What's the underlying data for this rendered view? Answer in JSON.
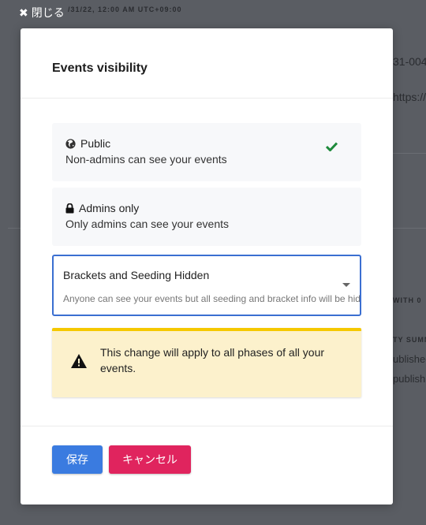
{
  "close": {
    "label": "閉じる"
  },
  "background": {
    "date_text": "/31/22, 12:00 AM UTC+09:00",
    "id_text": "31-004",
    "url_text": "https://",
    "with_text": "WITH 0",
    "summary_text": "TY SUMM",
    "published_1": "ublished",
    "published_2": "publish"
  },
  "modal": {
    "title": "Events visibility",
    "options": [
      {
        "title": "Public",
        "description": "Non-admins can see your events",
        "selected": true
      },
      {
        "title": "Admins only",
        "description": "Only admins can see your events",
        "selected": false
      }
    ],
    "dropdown": {
      "value": "Brackets and Seeding Hidden",
      "description": "Anyone can see your events but all seeding and bracket info will be hidden"
    },
    "warning": {
      "text": "This change will apply to all phases of all your events."
    },
    "buttons": {
      "save": "保存",
      "cancel": "キャンセル"
    }
  },
  "colors": {
    "accent_blue": "#3a7be0",
    "cancel_pink": "#e0245e",
    "warning_bg": "#fcf1cc",
    "warning_border": "#f5c800",
    "check_green": "#1e8a3b"
  }
}
